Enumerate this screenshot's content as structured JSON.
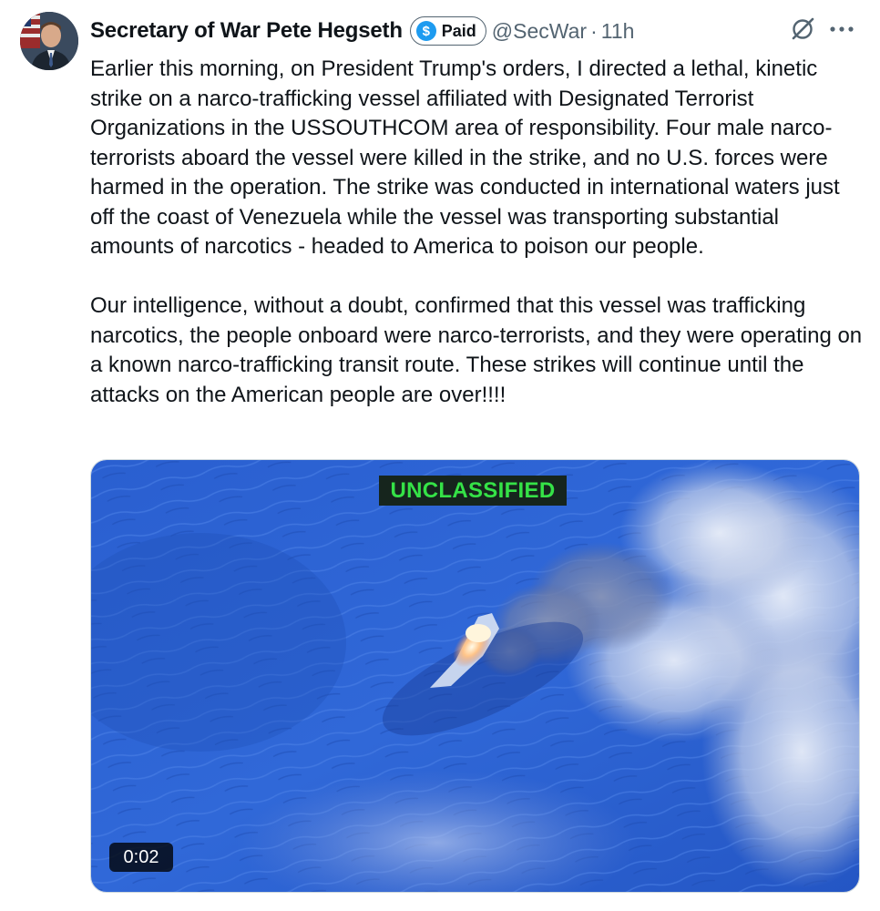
{
  "author": {
    "display_name": "Secretary of War Pete Hegseth",
    "badge_label": "Paid",
    "badge_icon": "dollar-icon",
    "badge_icon_glyph": "$",
    "handle": "@SecWar",
    "separator": "·",
    "time_ago": "11h",
    "accent_color": "#1d9bf0"
  },
  "tweet": {
    "paragraphs": [
      "Earlier this morning, on President Trump's orders, I directed a lethal, kinetic strike on a narco-trafficking vessel affiliated with Designated Terrorist Organizations in the USSOUTHCOM area of responsibility. Four male narco-terrorists aboard the vessel were killed in the strike, and no U.S. forces were harmed in the operation. The strike was conducted in international waters just off the coast of Venezuela while the vessel was transporting substantial amounts of narcotics - headed to America to poison our people.",
      "Our intelligence, without a doubt, confirmed that this vessel was trafficking narcotics, the people onboard were narco-terrorists, and they were operating on a known narco-trafficking transit route. These strikes will continue until the attacks on the American people are over!!!!"
    ]
  },
  "media": {
    "overlay_label": "UNCLASSIFIED",
    "video_timestamp": "0:02"
  },
  "icons": {
    "grok": "grok-icon",
    "more": "more-icon"
  }
}
